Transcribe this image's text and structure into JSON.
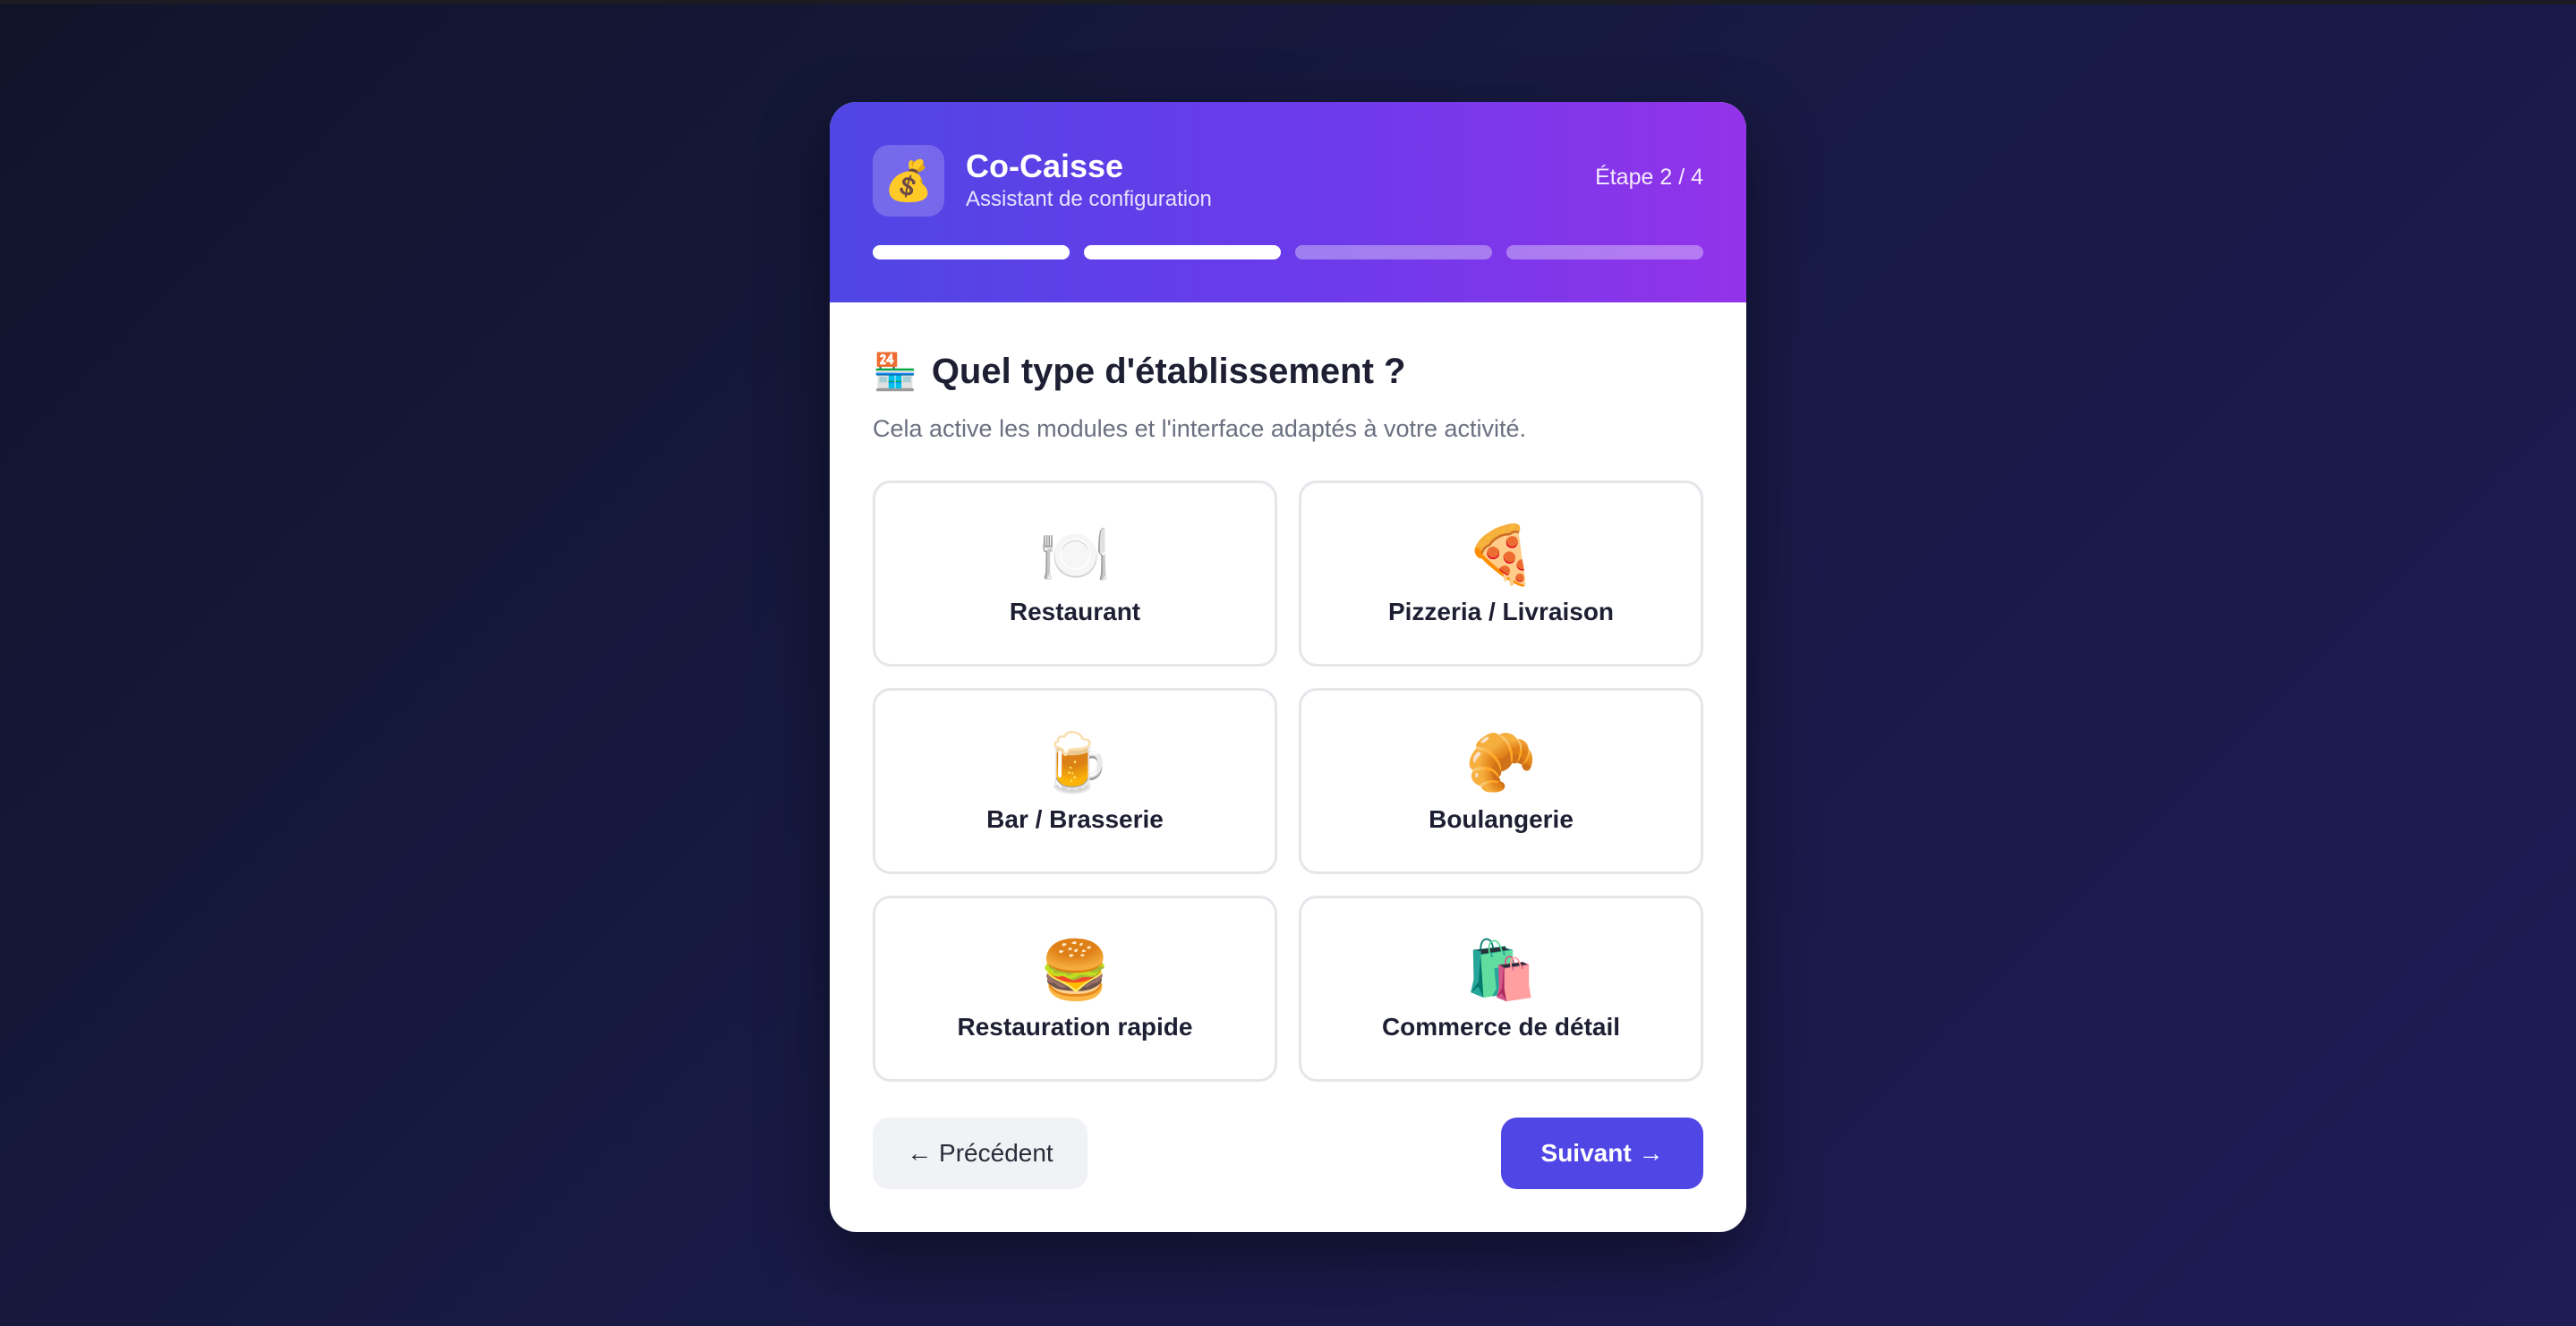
{
  "app": {
    "logo_icon": "💰",
    "name": "Co-Caisse",
    "subtitle": "Assistant de configuration",
    "step_label": "Étape 2 / 4",
    "progress": {
      "current_step": 2,
      "total_steps": 4
    }
  },
  "question": {
    "icon": "🏪",
    "title": "Quel type d'établissement ?",
    "subtitle": "Cela active les modules et l'interface adaptés à votre activité."
  },
  "options": [
    {
      "icon": "🍽️",
      "icon_name": "plate-cutlery-icon",
      "label": "Restaurant"
    },
    {
      "icon": "🍕",
      "icon_name": "pizza-icon",
      "label": "Pizzeria / Livraison"
    },
    {
      "icon": "🍺",
      "icon_name": "beer-mug-icon",
      "label": "Bar / Brasserie"
    },
    {
      "icon": "🥐",
      "icon_name": "croissant-icon",
      "label": "Boulangerie"
    },
    {
      "icon": "🍔",
      "icon_name": "burger-icon",
      "label": "Restauration rapide"
    },
    {
      "icon": "🛍️",
      "icon_name": "shopping-bags-icon",
      "label": "Commerce de détail"
    }
  ],
  "buttons": {
    "prev_label": "← Précédent",
    "next_label": "Suivant →"
  },
  "colors": {
    "accent": "#4f46e5",
    "header_gradient_start": "#4f46e5",
    "header_gradient_end": "#9333ea"
  }
}
